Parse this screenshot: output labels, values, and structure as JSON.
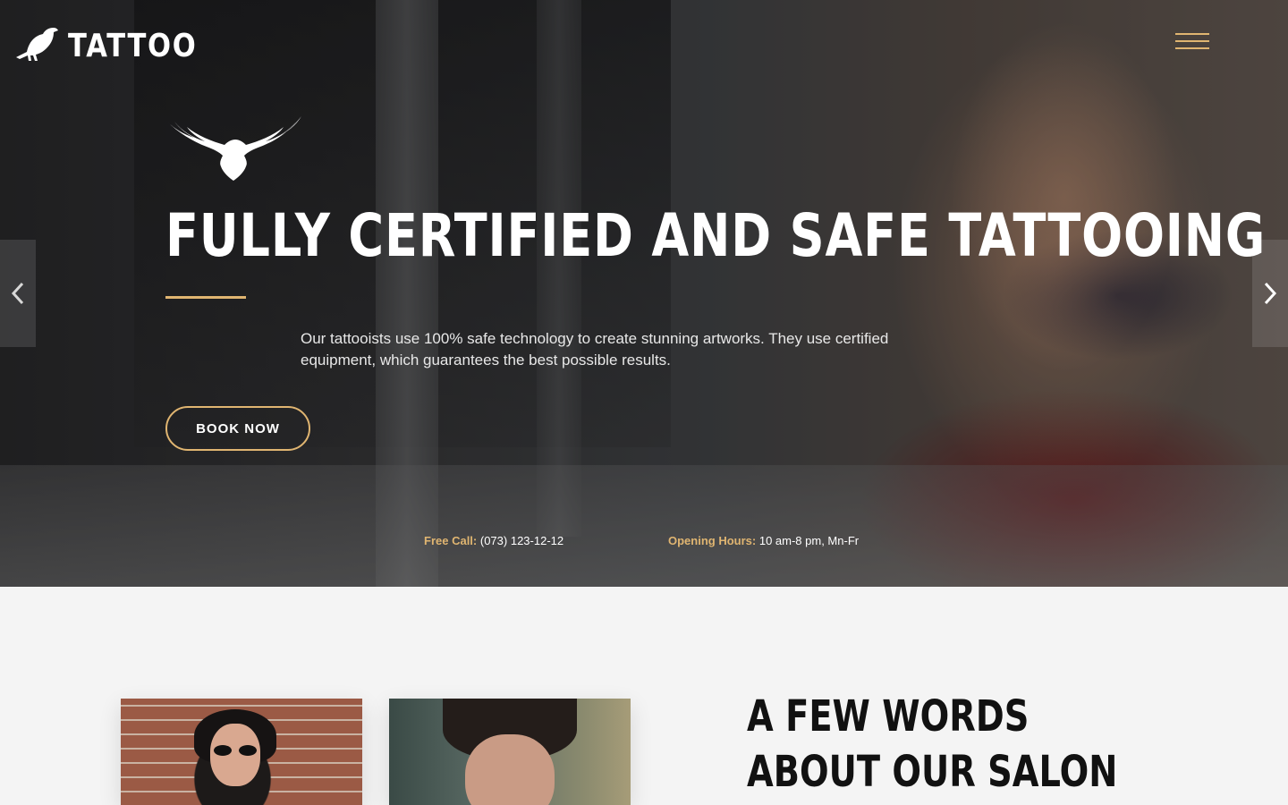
{
  "header": {
    "logo_text": "TATTOO",
    "logo_icon": "raven-icon",
    "menu_icon": "hamburger-menu-icon"
  },
  "hero": {
    "emblem_icon": "eagle-icon",
    "title": "FULLY CERTIFIED AND SAFE TATTOOING",
    "description": "Our tattooists use 100% safe technology to create stunning artworks. They use certified equipment, which guarantees the best possible results.",
    "cta_label": "BOOK NOW",
    "call_label": "Free Call:",
    "call_value": "(073) 123-12-12",
    "hours_label": "Opening Hours:",
    "hours_value": "10 am-8 pm, Mn-Fr",
    "prev_icon": "chevron-left-icon",
    "next_icon": "chevron-right-icon"
  },
  "about": {
    "title_line1": "A FEW WORDS",
    "title_line2": "ABOUT OUR SALON"
  },
  "colors": {
    "accent": "#e0b571",
    "page_background": "#f4f4f4",
    "title_text": "#111111"
  }
}
